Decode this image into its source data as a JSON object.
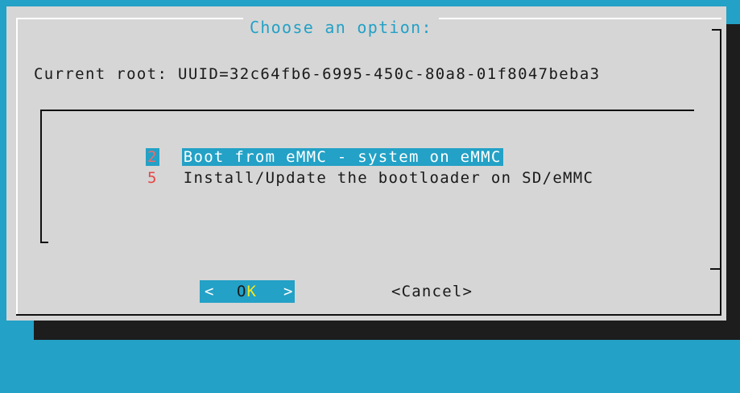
{
  "dialog": {
    "title": "Choose an option:",
    "current_root": "Current root: UUID=32c64fb6-6995-450c-80a8-01f8047beba3"
  },
  "menu": {
    "items": [
      {
        "tag": "2",
        "label": "Boot from eMMC - system on eMMC",
        "selected": true
      },
      {
        "tag": "5",
        "label": "Install/Update the bootloader on SD/eMMC",
        "selected": false
      }
    ]
  },
  "buttons": {
    "ok_left": "<",
    "ok_o": "O",
    "ok_k": "K",
    "ok_right": ">",
    "cancel": "<Cancel>"
  },
  "colors": {
    "background": "#23a1c6",
    "dialog": "#d6d6d6",
    "highlight": "#23a1c6",
    "hotkey": "#f4e81c",
    "tag": "#e84444"
  }
}
